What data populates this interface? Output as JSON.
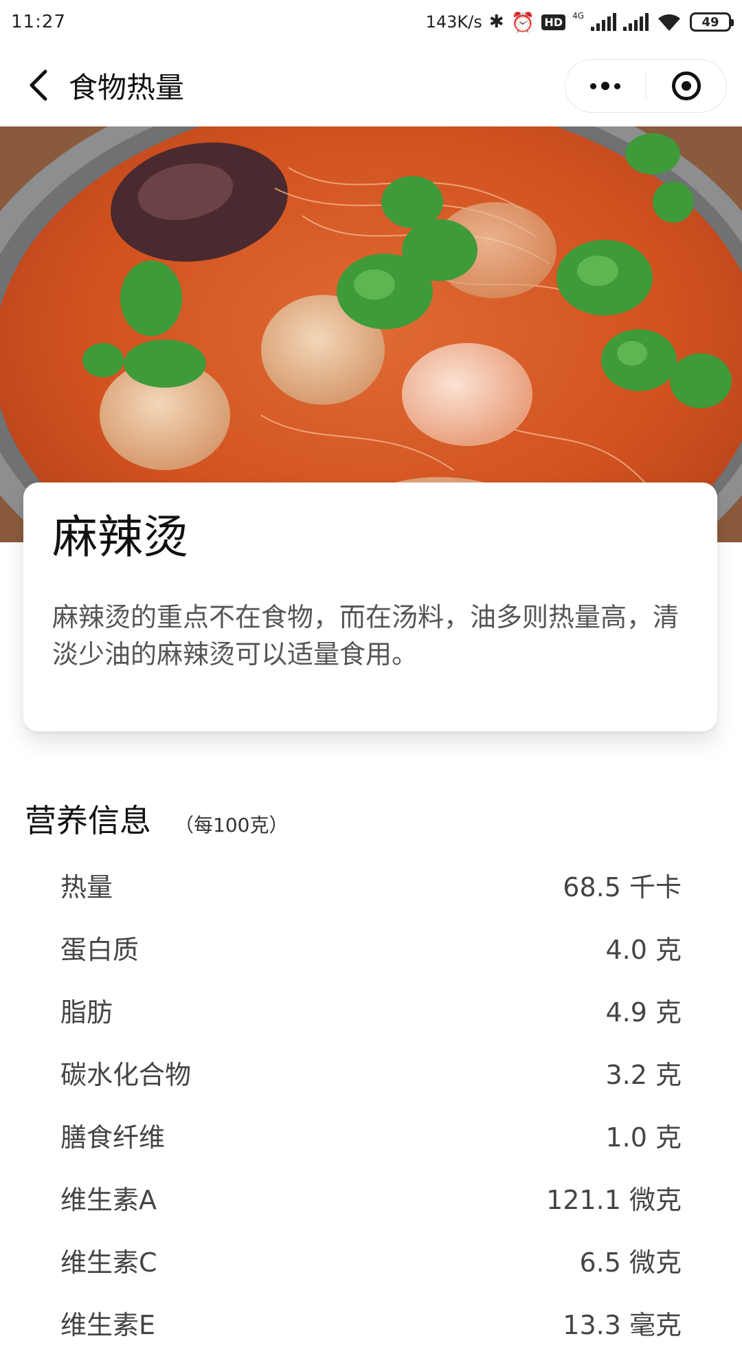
{
  "status_bar": {
    "time": "11:27",
    "net_speed": "143K/s",
    "hd_label": "HD",
    "network_type": "4G",
    "battery": "49"
  },
  "nav": {
    "title": "食物热量"
  },
  "hero": {
    "alt": "麻辣烫"
  },
  "food": {
    "name": "麻辣烫",
    "description": "麻辣烫的重点不在食物，而在汤料，油多则热量高，清淡少油的麻辣烫可以适量食用。"
  },
  "nutrition": {
    "title": "营养信息",
    "unit": "（每100克）",
    "items": [
      {
        "name": "热量",
        "value": "68.5 千卡"
      },
      {
        "name": "蛋白质",
        "value": "4.0 克"
      },
      {
        "name": "脂肪",
        "value": "4.9 克"
      },
      {
        "name": "碳水化合物",
        "value": "3.2 克"
      },
      {
        "name": "膳食纤维",
        "value": "1.0 克"
      },
      {
        "name": "维生素A",
        "value": "121.1 微克"
      },
      {
        "name": "维生素C",
        "value": "6.5 微克"
      },
      {
        "name": "维生素E",
        "value": "13.3 毫克"
      }
    ]
  }
}
